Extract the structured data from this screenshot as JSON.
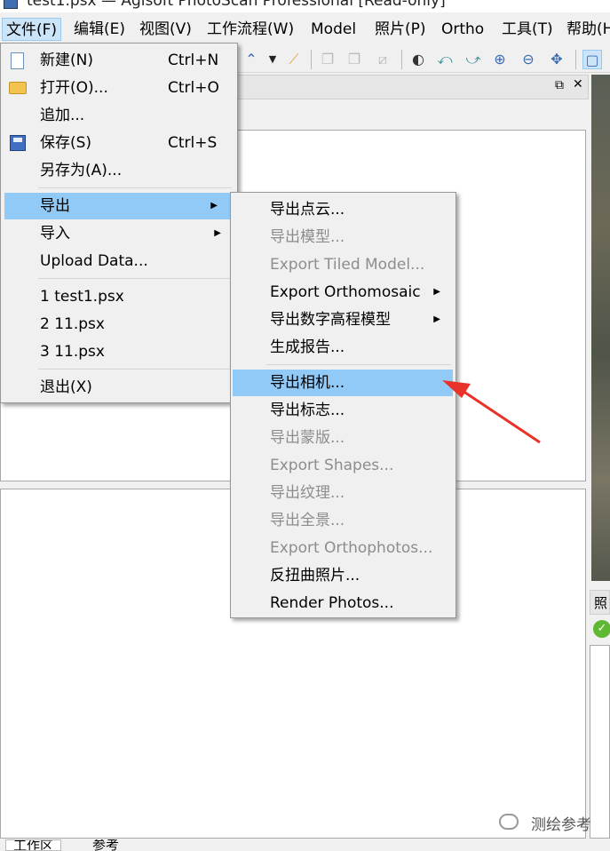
{
  "window": {
    "title": "test1.psx — Agisoft PhotoScan Professional [Read-only]"
  },
  "menubar": {
    "items": [
      {
        "label": "文件(F)"
      },
      {
        "label": "编辑(E)"
      },
      {
        "label": "视图(V)"
      },
      {
        "label": "工作流程(W)"
      },
      {
        "label": "Model"
      },
      {
        "label": "照片(P)"
      },
      {
        "label": "Ortho"
      },
      {
        "label": "工具(T)"
      },
      {
        "label": "帮助(H)"
      }
    ]
  },
  "file_menu": {
    "items": [
      {
        "label": "新建(N)",
        "shortcut": "Ctrl+N"
      },
      {
        "label": "打开(O)...",
        "shortcut": "Ctrl+O"
      },
      {
        "label": "追加..."
      },
      {
        "label": "保存(S)",
        "shortcut": "Ctrl+S"
      },
      {
        "label": "另存为(A)..."
      },
      {
        "label": "导出"
      },
      {
        "label": "导入"
      },
      {
        "label": "Upload Data..."
      },
      {
        "label": "1 test1.psx"
      },
      {
        "label": "2 11.psx"
      },
      {
        "label": "3 11.psx"
      },
      {
        "label": "退出(X)"
      }
    ]
  },
  "export_submenu": {
    "items": [
      {
        "label": "导出点云..."
      },
      {
        "label": "导出模型..."
      },
      {
        "label": "Export Tiled Model..."
      },
      {
        "label": "Export Orthomosaic"
      },
      {
        "label": "导出数字高程模型"
      },
      {
        "label": "生成报告..."
      },
      {
        "label": "导出相机..."
      },
      {
        "label": "导出标志..."
      },
      {
        "label": "导出蒙版..."
      },
      {
        "label": "Export Shapes..."
      },
      {
        "label": "导出纹理..."
      },
      {
        "label": "导出全景..."
      },
      {
        "label": "Export Orthophotos..."
      },
      {
        "label": "反扭曲照片..."
      },
      {
        "label": "Render Photos..."
      }
    ]
  },
  "right_panel": {
    "tab_label": "照"
  },
  "bottom_tabs": [
    {
      "label": "工作区"
    },
    {
      "label": "参考"
    }
  ],
  "watermark": {
    "text": "测绘参考"
  },
  "colors": {
    "highlight": "#91c9f7",
    "arrow": "#e8322a",
    "disabled": "#8d8d8d"
  }
}
